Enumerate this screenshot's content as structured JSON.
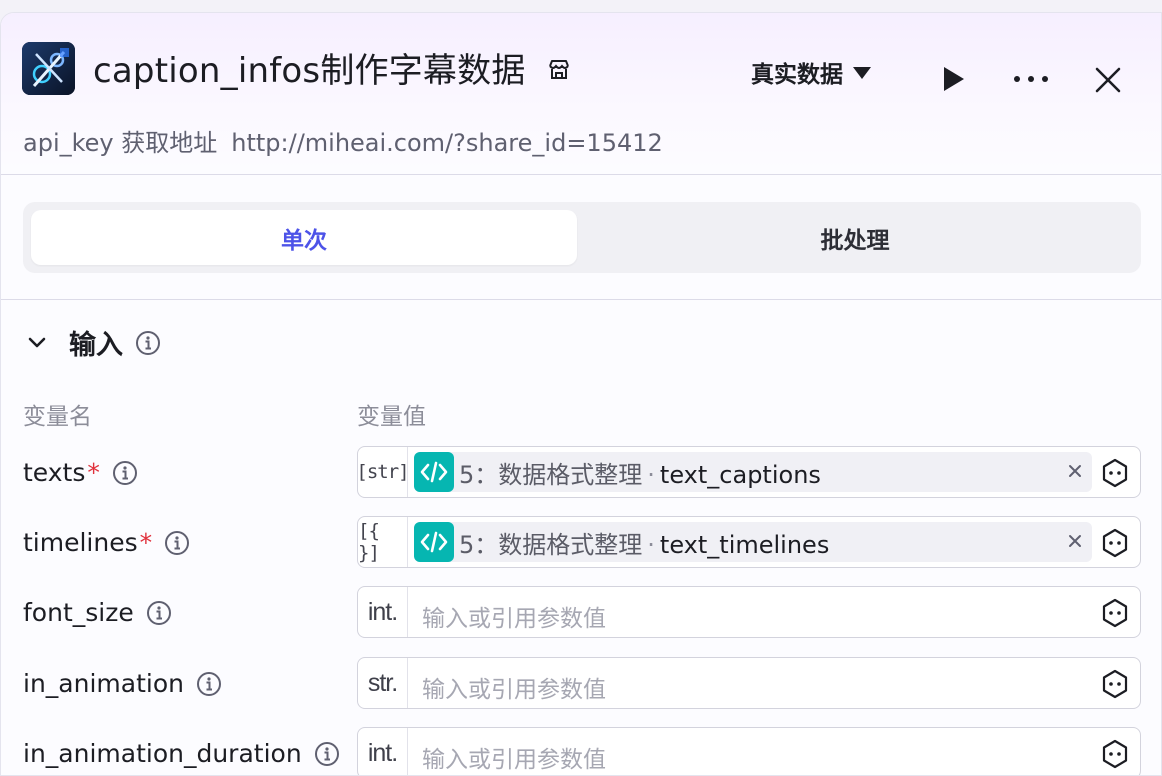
{
  "header": {
    "app_icon": "video-editor-icon",
    "title": "caption_infos制作字幕数据",
    "title_badge_icon": "store-icon",
    "data_mode": "真实数据",
    "subtitle_label": "api_key 获取地址",
    "subtitle_url": "http://miheai.com/?share_id=15412"
  },
  "tabs": [
    {
      "label": "单次",
      "active": true
    },
    {
      "label": "批处理",
      "active": false
    }
  ],
  "section": {
    "title": "输入",
    "col_name": "变量名",
    "col_value": "变量值"
  },
  "rows": [
    {
      "name": "texts",
      "required": "*",
      "type": "[str]",
      "ref_node": "5：数据格式整理",
      "ref_sep": "·",
      "ref_var": "text_captions"
    },
    {
      "name": "timelines",
      "required": "*",
      "type": "[{ }]",
      "ref_node": "5：数据格式整理",
      "ref_sep": "·",
      "ref_var": "text_timelines"
    },
    {
      "name": "font_size",
      "type": "int.",
      "placeholder": "输入或引用参数值"
    },
    {
      "name": "in_animation",
      "type": "str.",
      "placeholder": "输入或引用参数值"
    },
    {
      "name": "in_animation_duration",
      "type": "int.",
      "placeholder": "输入或引用参数值"
    }
  ],
  "colors": {
    "accent": "#4d53e8",
    "required": "#e0313c",
    "code_badge": "#06b6b1"
  }
}
